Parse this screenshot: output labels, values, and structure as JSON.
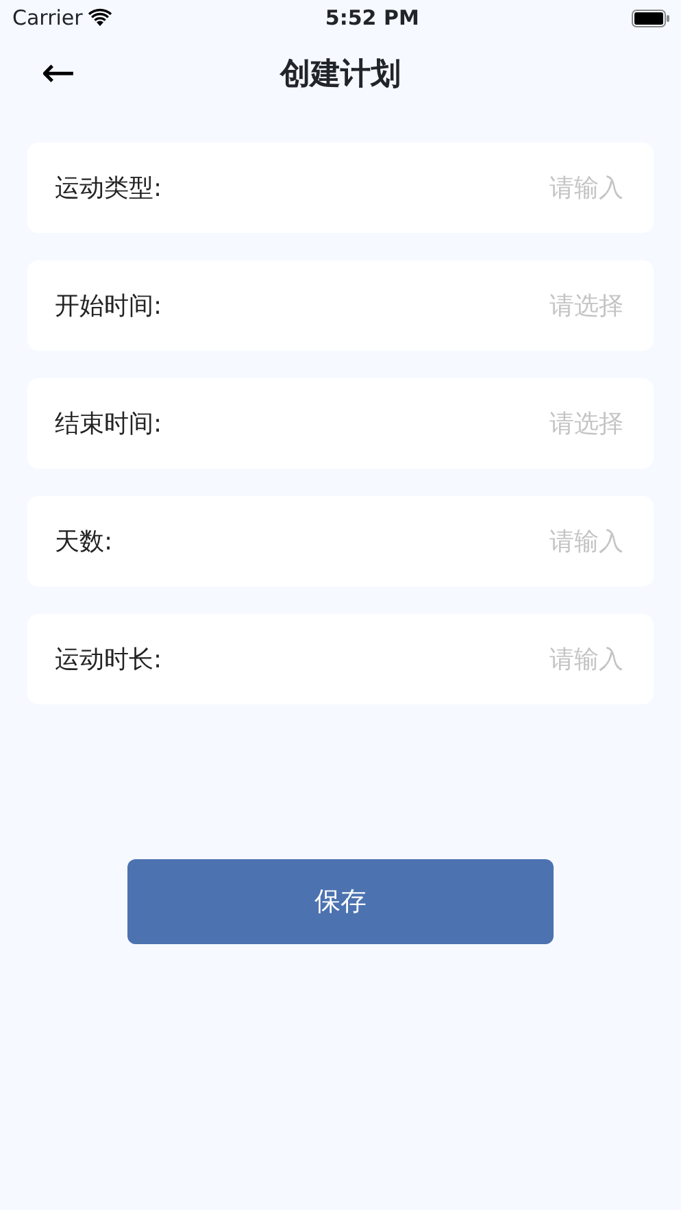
{
  "status_bar": {
    "carrier": "Carrier",
    "time": "5:52 PM"
  },
  "header": {
    "back": "←",
    "title": "创建计划"
  },
  "fields": [
    {
      "label": "运动类型:",
      "placeholder": "请输入"
    },
    {
      "label": "开始时间:",
      "placeholder": "请选择"
    },
    {
      "label": "结束时间:",
      "placeholder": "请选择"
    },
    {
      "label": "天数:",
      "placeholder": "请输入"
    },
    {
      "label": "运动时长:",
      "placeholder": "请输入"
    }
  ],
  "save_button": "保存"
}
